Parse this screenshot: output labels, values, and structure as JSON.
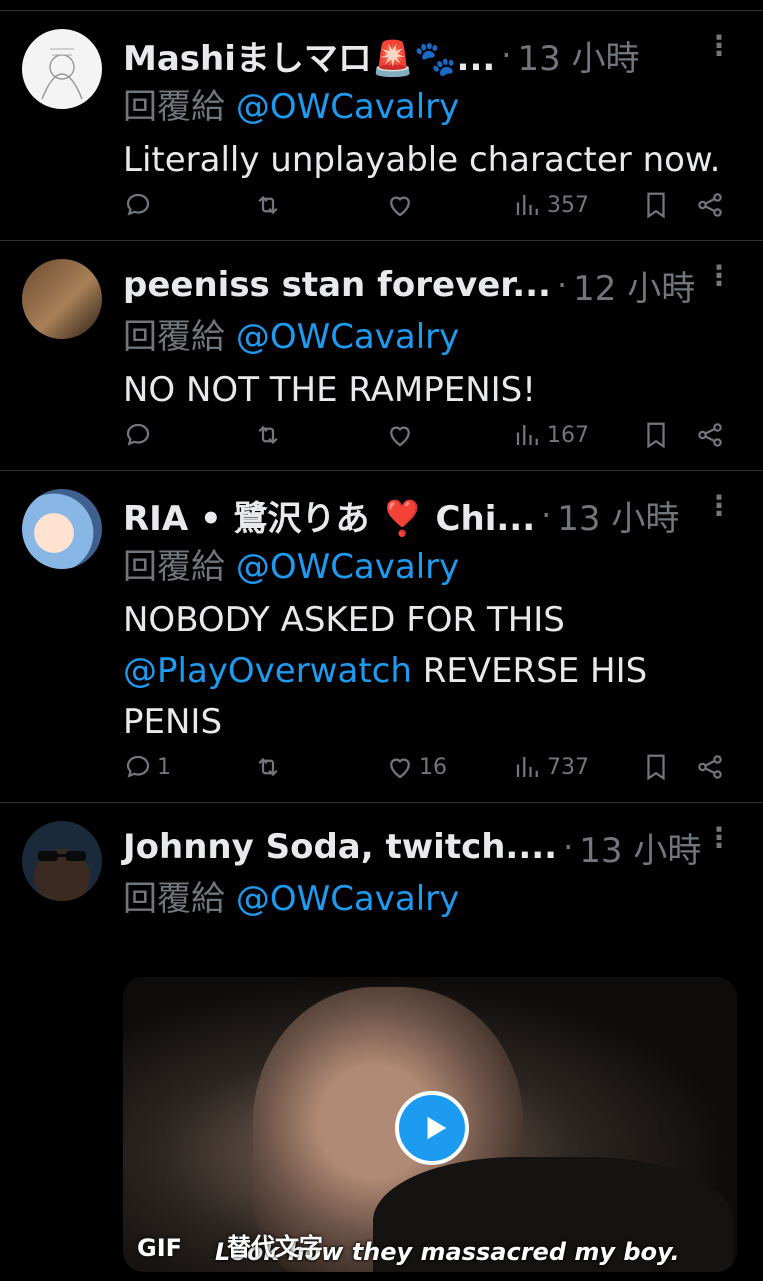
{
  "tweets": [
    {
      "name": "Mashiましマロ🚨🐾...",
      "time": "13 小時",
      "reply_prefix": "回覆給",
      "reply_handle": "@OWCavalry",
      "text": "Literally unplayable character now.",
      "replies": "",
      "likes": "",
      "views": "357"
    },
    {
      "name": "peeniss stan forever...",
      "time": "12 小時",
      "reply_prefix": "回覆給",
      "reply_handle": "@OWCavalry",
      "text": "NO NOT THE RAMPENIS!",
      "replies": "",
      "likes": "",
      "views": "167"
    },
    {
      "name": "RIA • 鷺沢りあ ❣️ Chi...",
      "time": "13 小時",
      "reply_prefix": "回覆給",
      "reply_handle": "@OWCavalry",
      "text_line1": "NOBODY ASKED FOR THIS",
      "text_mention": "@PlayOverwatch",
      "text_line2_rest": " REVERSE HIS",
      "text_line3": "PENIS",
      "replies": "1",
      "likes": "16",
      "views": "737"
    },
    {
      "name": "Johnny Soda, twitch....",
      "time": "13 小時",
      "reply_prefix": "回覆給",
      "reply_handle": "@OWCavalry",
      "media": {
        "gif_label": "GIF",
        "alt_label": "替代文字",
        "caption": "Look how they massacred my boy."
      }
    }
  ],
  "separator": "·",
  "more": "⋮",
  "colors": {
    "background": "#000000",
    "text": "#e7e9ea",
    "muted": "#71767b",
    "accent": "#1d9bf0",
    "border": "#2f3336"
  },
  "icons": [
    "reply-icon",
    "retweet-icon",
    "like-icon",
    "views-icon",
    "bookmark-icon",
    "share-icon",
    "more-icon",
    "play-icon"
  ]
}
